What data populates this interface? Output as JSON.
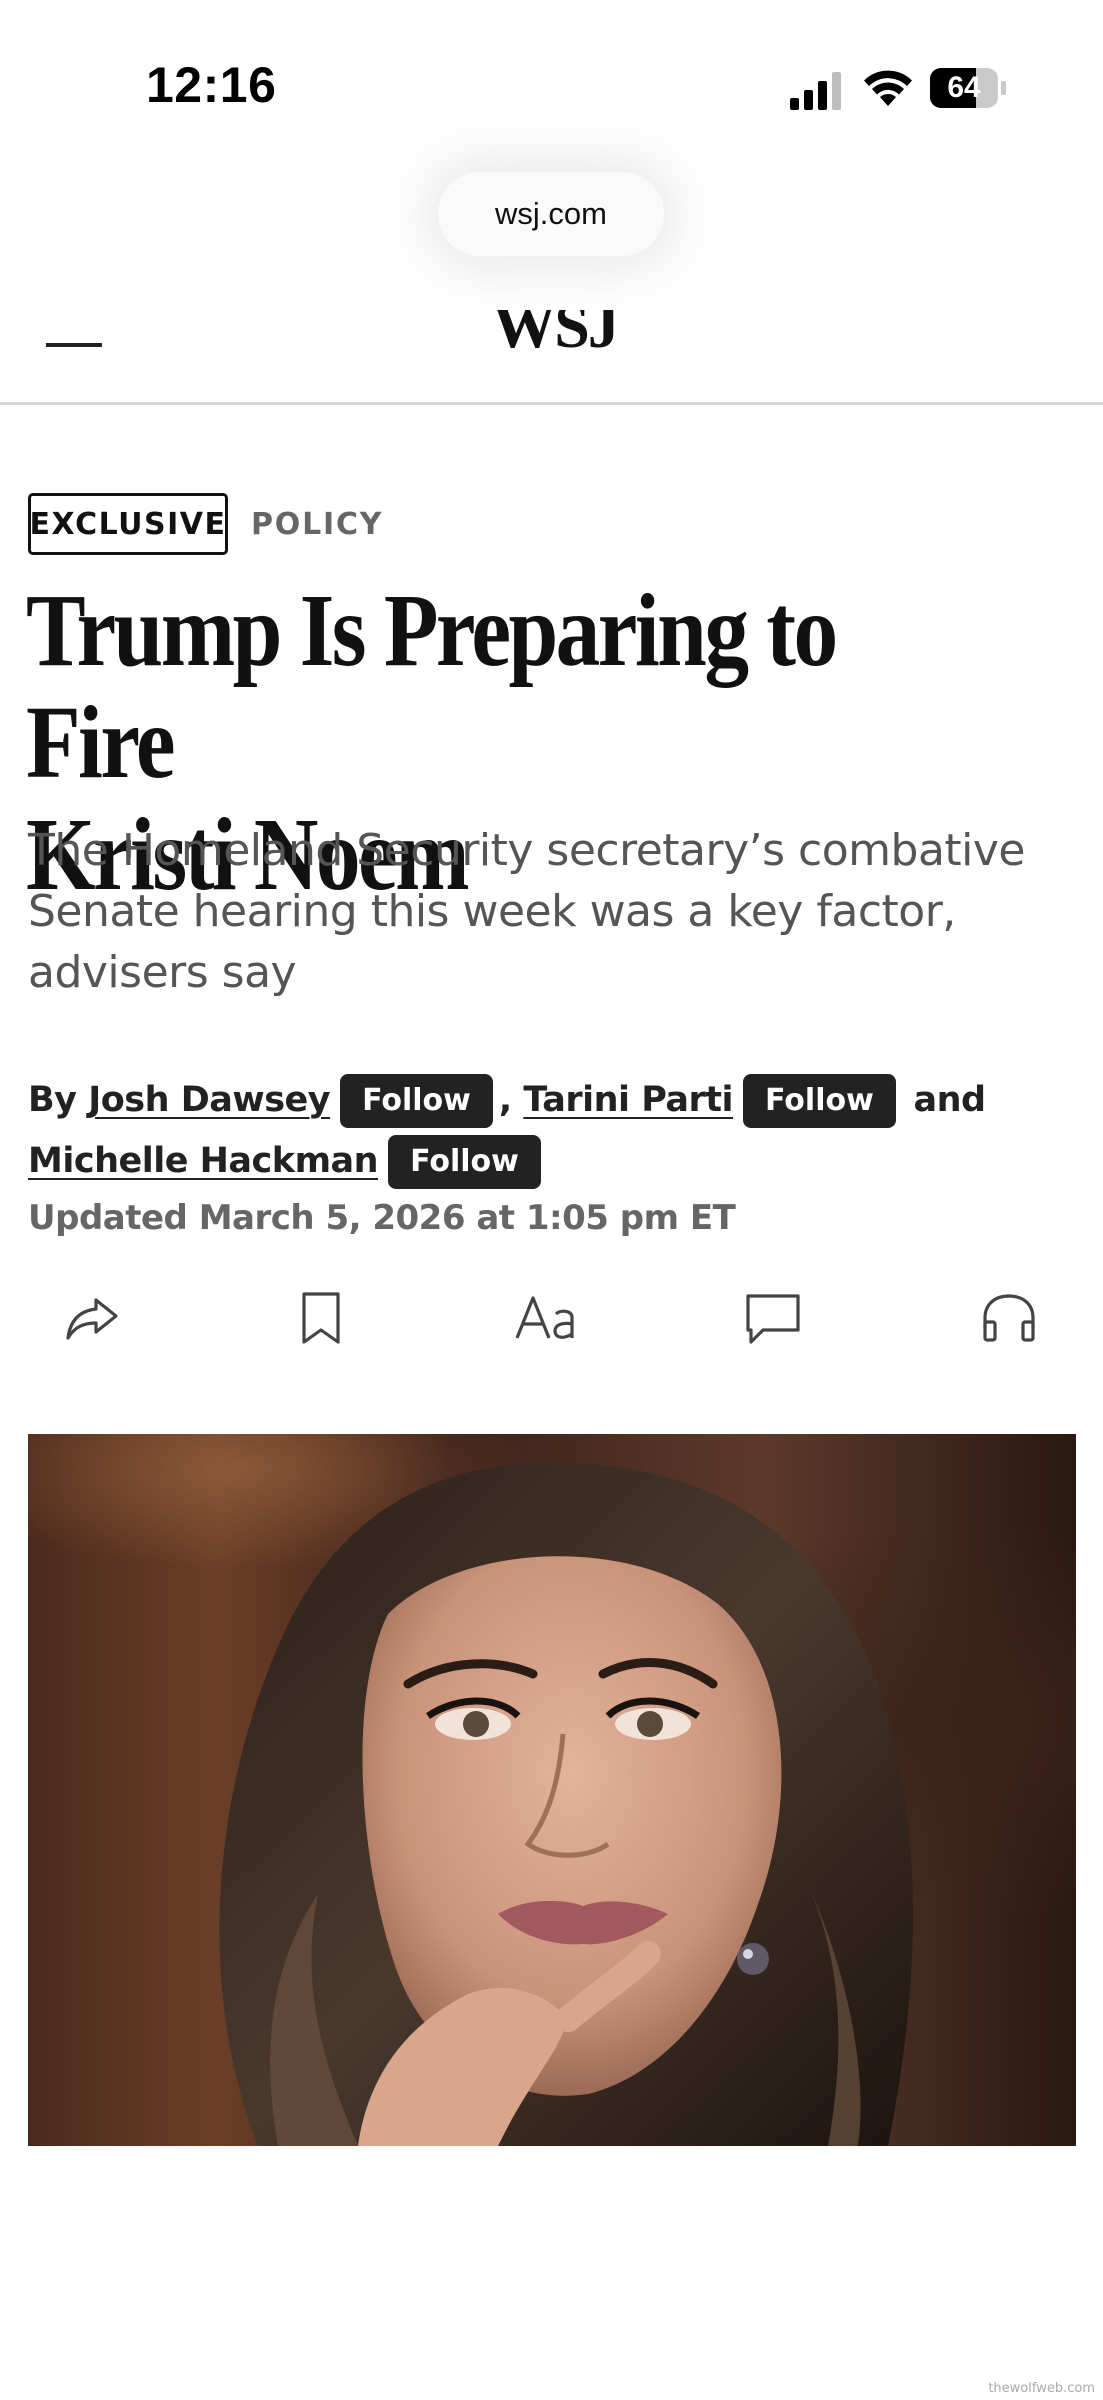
{
  "status_bar": {
    "time": "12:16",
    "battery": "64"
  },
  "browser": {
    "url": "wsj.com"
  },
  "nav": {
    "logo": "WSJ"
  },
  "article": {
    "badge": "EXCLUSIVE",
    "section": "POLICY",
    "headline_line1": "Trump Is Preparing to Fire",
    "headline_line2": "Kristi Noem",
    "dek": "The Homeland Security secretary’s combative Senate hearing this week was a key factor, advisers say",
    "byline": {
      "prefix": "By",
      "authors": [
        "Josh Dawsey",
        "Tarini Parti",
        "Michelle Hackman"
      ],
      "follow_label": "Follow",
      "separator": ",",
      "conjunction": "and"
    },
    "updated": "Updated March 5, 2026 at 1:05 pm ET"
  },
  "toolbar": {
    "icons": [
      "share-icon",
      "bookmark-icon",
      "text-size-icon",
      "comments-icon",
      "listen-icon"
    ],
    "text_size_label": "Aa"
  },
  "image": {
    "alt": "Kristi Noem portrait"
  },
  "watermark": "thewolfweb.com"
}
